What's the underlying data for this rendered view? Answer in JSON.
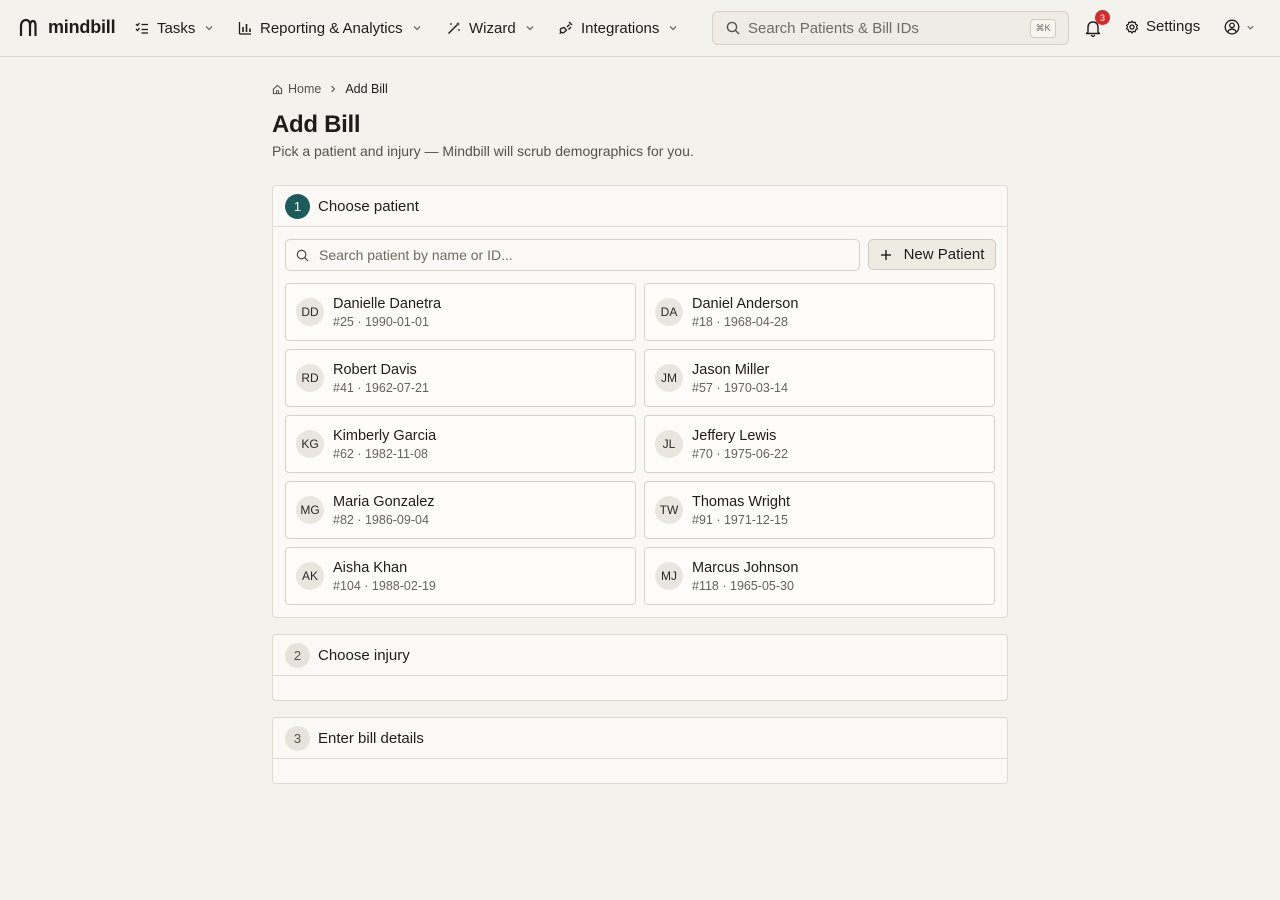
{
  "brand": {
    "name": "mindbill",
    "icon": "mindbill-logo-icon"
  },
  "nav": {
    "items": [
      {
        "label": "Tasks",
        "icon": "task-list-icon"
      },
      {
        "label": "Reporting & Analytics",
        "icon": "bar-chart-icon"
      },
      {
        "label": "Wizard",
        "icon": "magic-wand-icon"
      },
      {
        "label": "Integrations",
        "icon": "plug-icon"
      }
    ],
    "search_placeholder": "Search Patients & Bill IDs",
    "search_shortcut": "⌘K",
    "notifications_count": "3",
    "settings_label": "Settings"
  },
  "breadcrumb": {
    "home": "Home",
    "current": "Add Bill"
  },
  "page": {
    "title": "Add Bill",
    "subtitle": "Pick a patient and injury — Mindbill will scrub demographics for you."
  },
  "steps": [
    {
      "number": "1",
      "title": "Choose patient"
    },
    {
      "number": "2",
      "title": "Choose injury"
    },
    {
      "number": "3",
      "title": "Enter bill details"
    }
  ],
  "patient_search": {
    "placeholder": "Search patient by name or ID..."
  },
  "new_patient_label": "New Patient",
  "patients": [
    {
      "initials": "DD",
      "name": "Danielle Danetra",
      "meta": "#25 · 1990-01-01"
    },
    {
      "initials": "DA",
      "name": "Daniel Anderson",
      "meta": "#18 · 1968-04-28"
    },
    {
      "initials": "RD",
      "name": "Robert Davis",
      "meta": "#41 · 1962-07-21"
    },
    {
      "initials": "JM",
      "name": "Jason Miller",
      "meta": "#57 · 1970-03-14"
    },
    {
      "initials": "KG",
      "name": "Kimberly Garcia",
      "meta": "#62 · 1982-11-08"
    },
    {
      "initials": "JL",
      "name": "Jeffery Lewis",
      "meta": "#70 · 1975-06-22"
    },
    {
      "initials": "MG",
      "name": "Maria Gonzalez",
      "meta": "#82 · 1986-09-04"
    },
    {
      "initials": "TW",
      "name": "Thomas Wright",
      "meta": "#91 · 1971-12-15"
    },
    {
      "initials": "AK",
      "name": "Aisha Khan",
      "meta": "#104 · 1988-02-19"
    },
    {
      "initials": "MJ",
      "name": "Marcus Johnson",
      "meta": "#118 · 1965-05-30"
    }
  ],
  "colors": {
    "accent": "#1d5a5a",
    "badge": "#d52b2b",
    "background": "#f4f2ec"
  }
}
